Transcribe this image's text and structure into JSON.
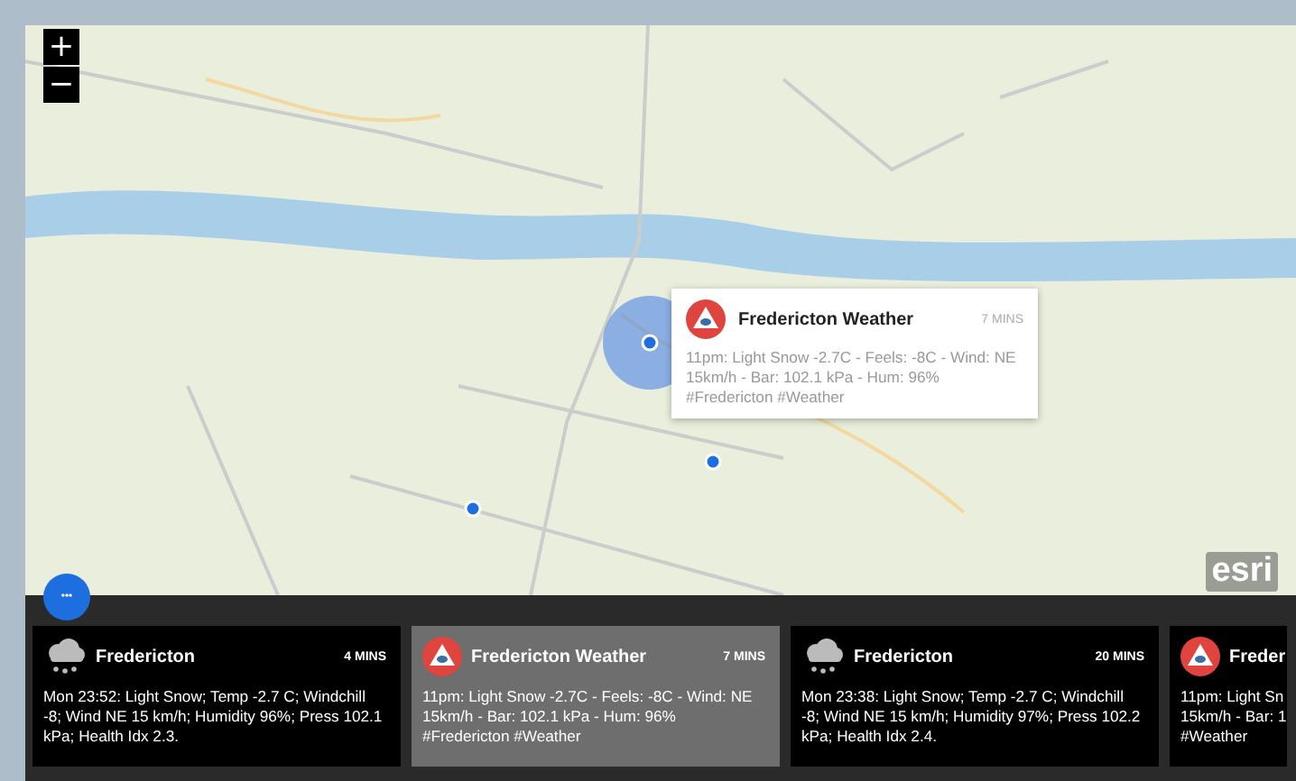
{
  "map": {
    "zoom_in": "+",
    "zoom_out": "−",
    "attribution": "esri",
    "more_button": "•••"
  },
  "popup": {
    "kind": "alert",
    "title": "Fredericton Weather",
    "time": "7 MINS",
    "body": "11pm: Light Snow -2.7C - Feels: -8C - Wind: NE 15km/h - Bar: 102.1 kPa - Hum: 96% #Fredericton #Weather"
  },
  "cards": [
    {
      "kind": "snow",
      "title": "Fredericton",
      "time": "4 MINS",
      "body": "Mon 23:52: Light Snow; Temp -2.7 C; Windchill -8; Wind NE 15 km/h; Humidity 96%; Press 102.1 kPa; Health Idx 2.3.",
      "selected": false
    },
    {
      "kind": "alert",
      "title": "Fredericton Weather",
      "time": "7 MINS",
      "body": "11pm: Light Snow -2.7C - Feels: -8C - Wind: NE 15km/h - Bar: 102.1 kPa - Hum: 96% #Fredericton #Weather",
      "selected": true
    },
    {
      "kind": "snow",
      "title": "Fredericton",
      "time": "20 MINS",
      "body": "Mon 23:38: Light Snow; Temp -2.7 C; Windchill -8; Wind NE 15 km/h; Humidity 97%; Press 102.2 kPa; Health Idx 2.4.",
      "selected": false
    },
    {
      "kind": "alert",
      "title": "Freder",
      "body": "11pm: Light Sn\n15km/h - Bar: 1\n#Weather",
      "selected": false
    }
  ]
}
